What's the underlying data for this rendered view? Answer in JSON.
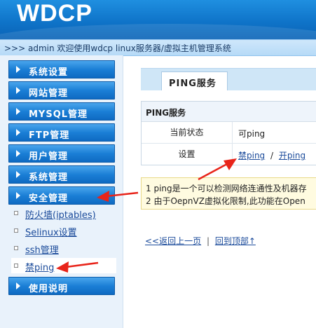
{
  "header": {
    "logo": "WDCP"
  },
  "topbar": {
    "text": ">>> admin 欢迎使用wdcp linux服务器/虚拟主机管理系统"
  },
  "sidebar": {
    "menu": [
      {
        "label": "系统设置"
      },
      {
        "label": "网站管理"
      },
      {
        "label": "MYSQL管理"
      },
      {
        "label": "FTP管理"
      },
      {
        "label": "用户管理"
      },
      {
        "label": "系统管理"
      },
      {
        "label": "安全管理"
      },
      {
        "label": "使用说明"
      }
    ],
    "submenu": [
      {
        "label": "防火墙(iptables)"
      },
      {
        "label": "Selinux设置"
      },
      {
        "label": "ssh管理"
      },
      {
        "label": "禁ping"
      }
    ]
  },
  "main": {
    "tab": "PING服务",
    "panel": {
      "title": "PING服务",
      "status_key": "当前状态",
      "status_value": "可ping",
      "settings_key": "设置",
      "disable_ping": "禁ping",
      "separator": "/",
      "enable_ping": "开ping"
    },
    "notice": {
      "line1": "1 ping是一个可以检测网络连通性及机器存",
      "line2": "2 由于OepnVZ虚拟化限制,此功能在Open"
    },
    "links": {
      "back": "<<返回上一页",
      "separator": "|",
      "top": "回到顶部↑"
    }
  },
  "colors": {
    "accent": "#1b7fd6",
    "annotation": "#e8241a"
  }
}
